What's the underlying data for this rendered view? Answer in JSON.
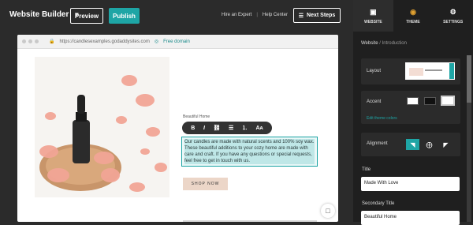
{
  "topbar": {
    "brand": "Website Builder",
    "preview_label": "Preview",
    "publish_label": "Publish",
    "hire_expert": "Hire an Expert",
    "separator": "|",
    "help_center": "Help Center",
    "next_steps": "Next Steps"
  },
  "browser": {
    "url": "https://candlesexamples.godaddysites.com",
    "free_domain": "Free domain"
  },
  "content": {
    "kicker": "Beautiful Home",
    "body": "Our candles are made with natural scents and 100% soy wax. These beautiful additions to your cozy home are made with care and craft. If you have any questions or special requests, feel free to get in touch with us.",
    "shop_now": "SHOP NOW",
    "toolbar": {
      "bold": "B",
      "italic": "I",
      "link": "⛓",
      "bullets": "☰",
      "numbers": "⒈",
      "size": "Aᴀ"
    }
  },
  "panel": {
    "tabs": [
      {
        "label": "WEBSITE",
        "icon": "window-icon"
      },
      {
        "label": "THEME",
        "icon": "palette-icon"
      },
      {
        "label": "SETTINGS",
        "icon": "gear-icon"
      }
    ],
    "breadcrumb": {
      "root": "Website",
      "sep": "/",
      "current": "Introduction"
    },
    "layout_label": "Layout",
    "accent_label": "Accent",
    "edit_theme": "Edit theme colors",
    "alignment_label": "Alignment",
    "title_label": "Title",
    "title_value": "Made With Love",
    "secondary_title_label": "Secondary Title",
    "secondary_title_value": "Beautiful Home"
  },
  "colors": {
    "accent": "#1ea5a5",
    "dark_bg": "#2b2b2b",
    "panel_bg": "#1f1f1f"
  }
}
